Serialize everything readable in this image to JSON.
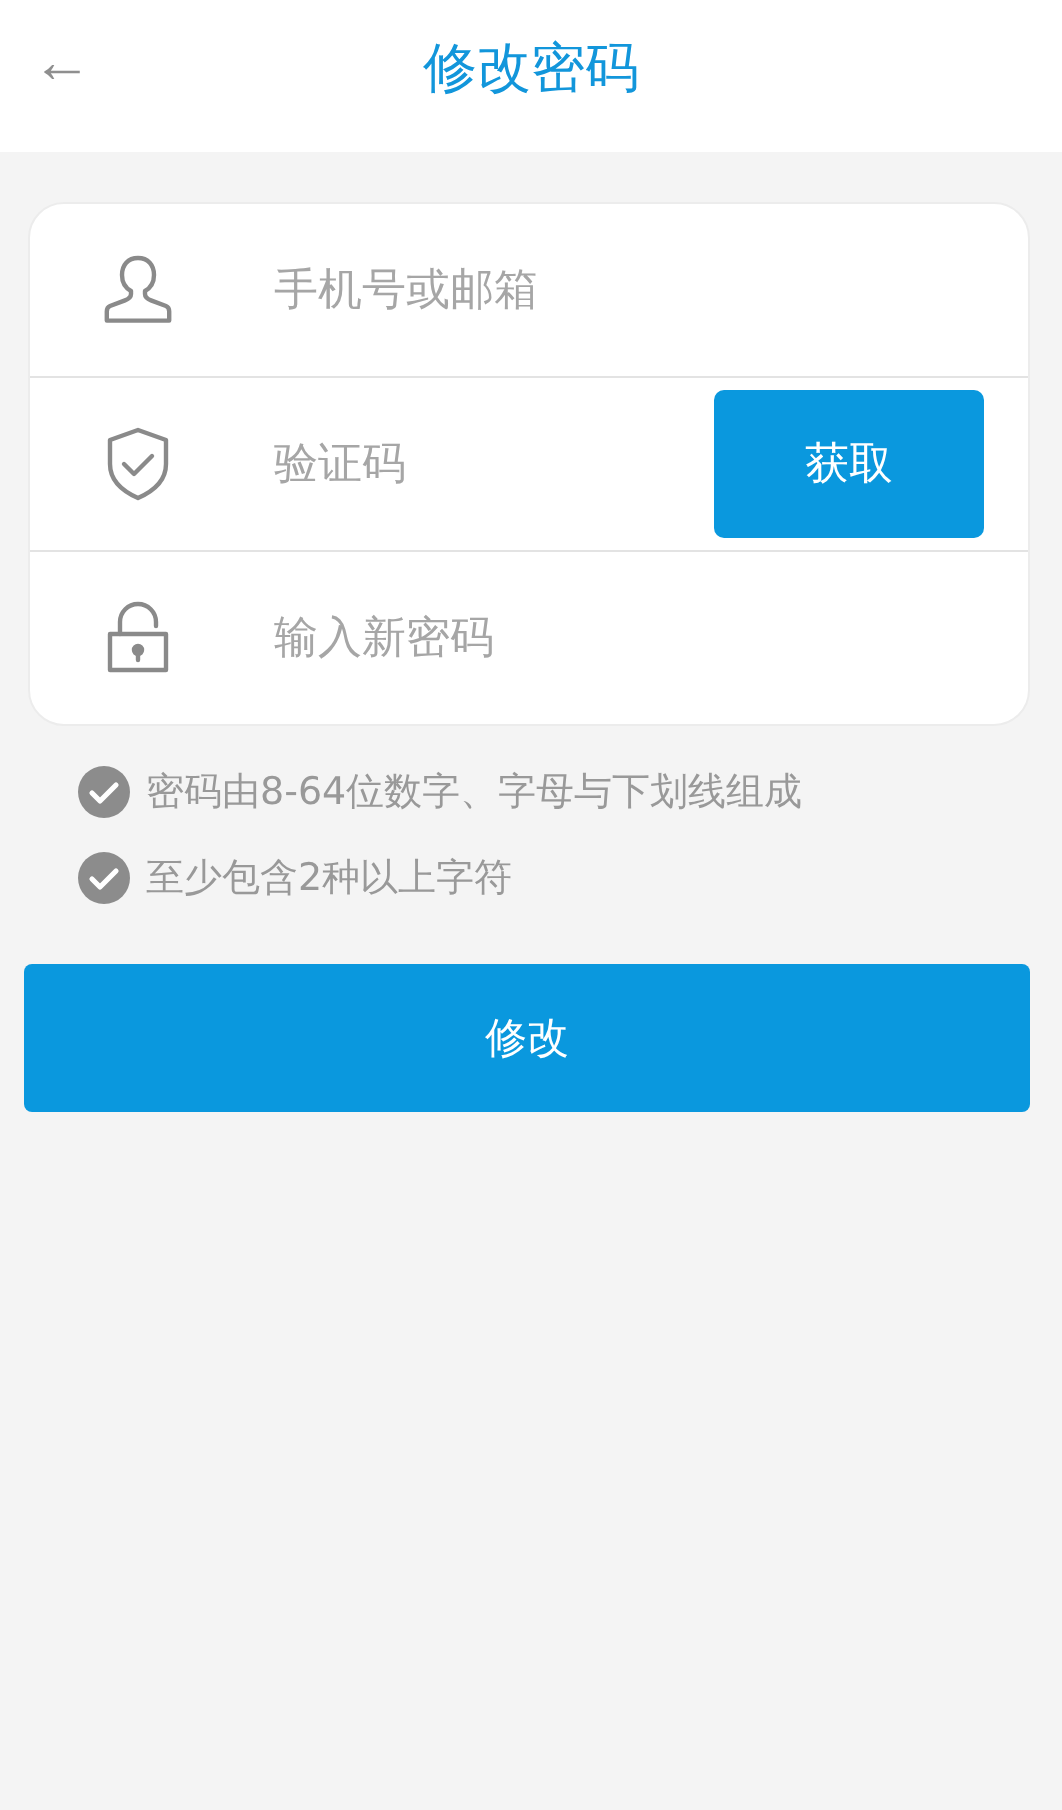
{
  "header": {
    "back": "←",
    "title": "修改密码"
  },
  "fields": [
    {
      "kind": "user",
      "placeholder": "手机号或邮箱"
    },
    {
      "kind": "code",
      "placeholder": "验证码",
      "button": "获取"
    },
    {
      "kind": "lock",
      "placeholder": "输入新密码"
    }
  ],
  "rules": [
    "密码由8-64位数字、字母与下划线组成",
    "至少包含2种以上字符"
  ],
  "submit": "修改"
}
